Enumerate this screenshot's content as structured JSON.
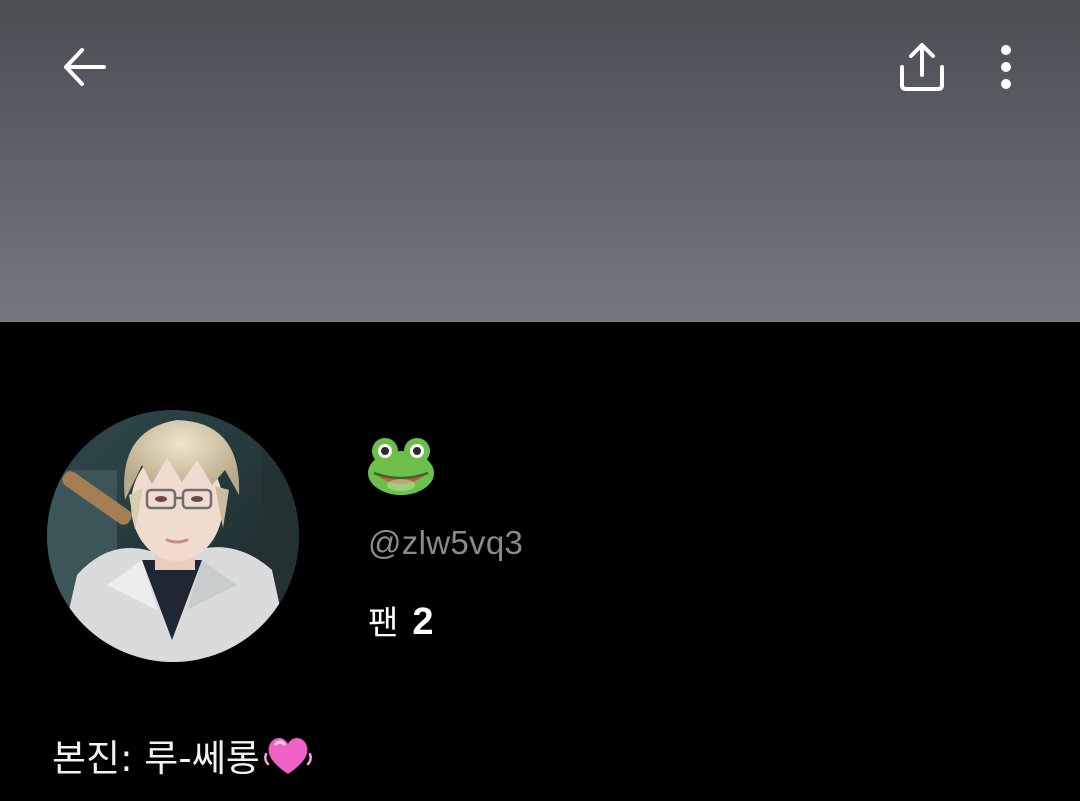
{
  "header": {
    "icons": [
      "back-arrow-icon",
      "share-icon",
      "more-vertical-icon"
    ]
  },
  "profile": {
    "name_emoji": "frog-face-icon",
    "handle": "@zlw5vq3",
    "fans_label": "팬",
    "fans_count": "2",
    "bio_text": "본진: 루-쎄롱",
    "bio_emoji": "pink-heart-icon"
  },
  "colors": {
    "background": "#000000",
    "cover_top": "#4a4d52",
    "cover_bottom": "#75797f",
    "handle_text": "#8a8a8e",
    "primary_text": "#ffffff"
  }
}
